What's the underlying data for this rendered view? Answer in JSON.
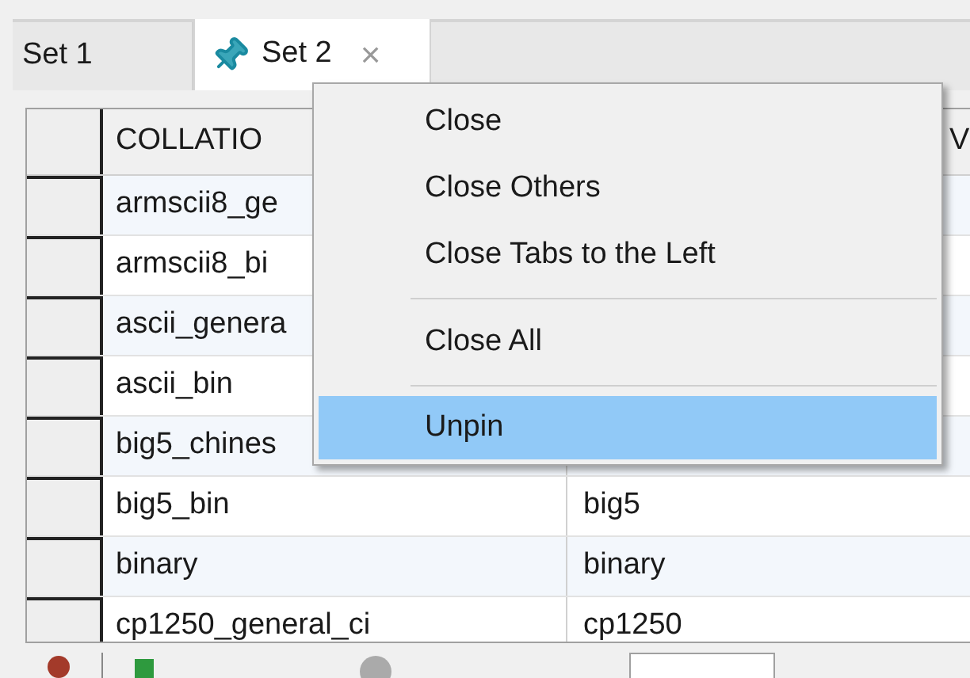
{
  "tabs": [
    {
      "label": "Set 1",
      "selected": false,
      "pinned": false
    },
    {
      "label": "Set 2",
      "selected": true,
      "pinned": true,
      "close_glyph": "×"
    }
  ],
  "table": {
    "columns": [
      "COLLATIO",
      "V"
    ],
    "rows": [
      {
        "cells": [
          "armscii8_ge",
          ""
        ]
      },
      {
        "cells": [
          "armscii8_bi",
          ""
        ]
      },
      {
        "cells": [
          "ascii_genera",
          ""
        ]
      },
      {
        "cells": [
          "ascii_bin",
          ""
        ]
      },
      {
        "cells": [
          "big5_chines",
          ""
        ]
      },
      {
        "cells": [
          "big5_bin",
          "big5"
        ]
      },
      {
        "cells": [
          "binary",
          "binary"
        ]
      },
      {
        "cells": [
          "cp1250_general_ci",
          "cp1250"
        ]
      }
    ]
  },
  "context_menu": {
    "items": [
      {
        "kind": "item",
        "label": "Close",
        "selected": false
      },
      {
        "kind": "item",
        "label": "Close Others",
        "selected": false
      },
      {
        "kind": "item",
        "label": "Close Tabs to the Left",
        "selected": false
      },
      {
        "kind": "separator"
      },
      {
        "kind": "item",
        "label": "Close All",
        "selected": false
      },
      {
        "kind": "separator"
      },
      {
        "kind": "item",
        "label": "Unpin",
        "selected": true
      }
    ]
  }
}
